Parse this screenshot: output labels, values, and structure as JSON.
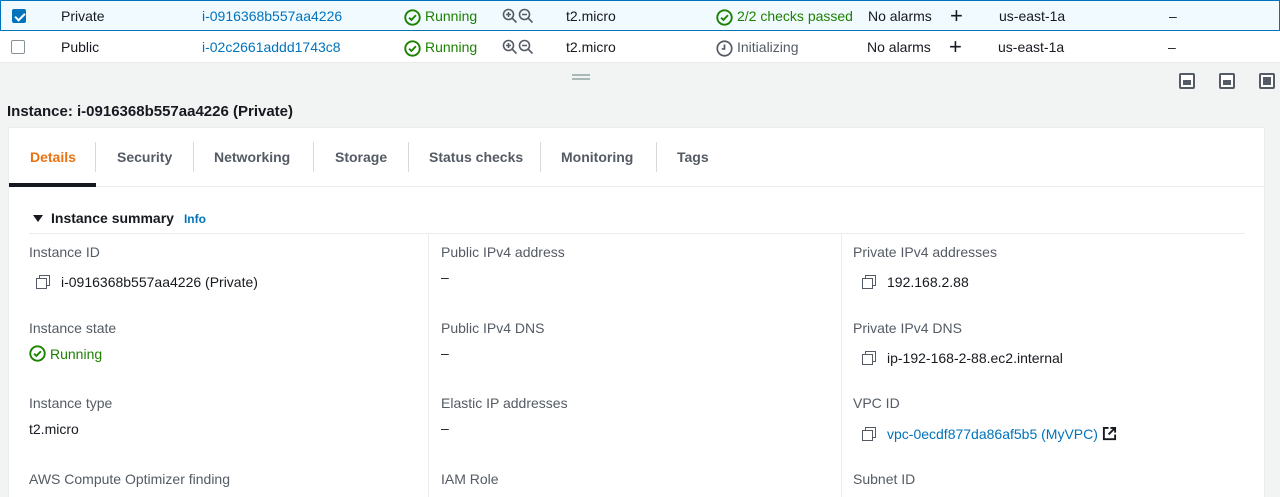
{
  "instances": {
    "rows": [
      {
        "name": "Private",
        "id": "i-0916368b557aa4226",
        "state": "Running",
        "type": "t2.micro",
        "status_check": "2/2 checks passed",
        "alarms": "No alarms",
        "az": "us-east-1a",
        "public_dns": "–"
      },
      {
        "name": "Public",
        "id": "i-02c2661addd1743c8",
        "state": "Running",
        "type": "t2.micro",
        "status_check": "Initializing",
        "alarms": "No alarms",
        "az": "us-east-1a",
        "public_dns": "–"
      }
    ]
  },
  "details": {
    "title": "Instance: i-0916368b557aa4226 (Private)",
    "tabs": [
      "Details",
      "Security",
      "Networking",
      "Storage",
      "Status checks",
      "Monitoring",
      "Tags"
    ],
    "summary": {
      "heading": "Instance summary",
      "info": "Info",
      "instance_id_label": "Instance ID",
      "instance_id_value": "i-0916368b557aa4226 (Private)",
      "instance_state_label": "Instance state",
      "instance_state_value": "Running",
      "instance_type_label": "Instance type",
      "instance_type_value": "t2.micro",
      "optimizer_label": "AWS Compute Optimizer finding",
      "public_ipv4_label": "Public IPv4 address",
      "public_ipv4_value": "–",
      "public_dns_label": "Public IPv4 DNS",
      "public_dns_value": "–",
      "elastic_ip_label": "Elastic IP addresses",
      "elastic_ip_value": "–",
      "iam_role_label": "IAM Role",
      "private_ipv4_label": "Private IPv4 addresses",
      "private_ipv4_value": "192.168.2.88",
      "private_dns_label": "Private IPv4 DNS",
      "private_dns_value": "ip-192-168-2-88.ec2.internal",
      "vpc_id_label": "VPC ID",
      "vpc_id_value": "vpc-0ecdf877da86af5b5 (MyVPC)",
      "subnet_id_label": "Subnet ID"
    }
  },
  "colors": {
    "link": "#0073bb",
    "success": "#1d8102",
    "active_tab": "#ec7211",
    "selected_row_bg": "#f1faff"
  },
  "icons": [
    "checkbox",
    "status-ok-icon",
    "zoom-in-icon",
    "zoom-out-icon",
    "clock-icon",
    "plus-icon",
    "copy-icon",
    "external-link-icon",
    "panel-bottom-icon",
    "panel-split-icon",
    "panel-full-icon"
  ]
}
